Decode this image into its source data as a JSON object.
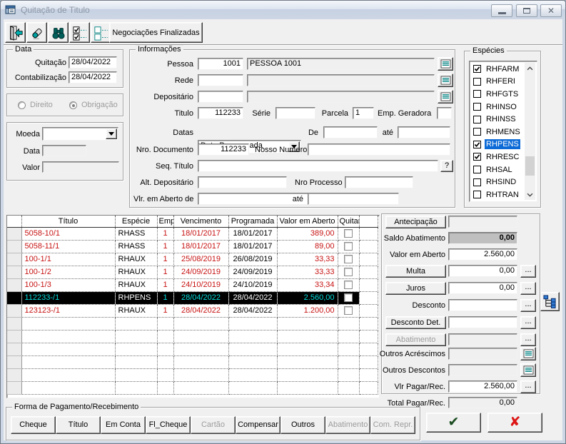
{
  "window": {
    "title": "Quitação de Titulo"
  },
  "toolbar": {
    "icons": [
      "exit-icon",
      "eraser-icon",
      "search-icon",
      "check-all-icon",
      "uncheck-all-icon"
    ],
    "finalizadas_label": "Negociações Finalizadas"
  },
  "data_group": {
    "title": "Data",
    "rows": [
      {
        "label": "Quitação",
        "value": "28/04/2022"
      },
      {
        "label": "Contabilização",
        "value": "28/04/2022"
      }
    ]
  },
  "tipo_group": {
    "options": [
      {
        "label": "Direito",
        "selected": false
      },
      {
        "label": "Obrigação",
        "selected": true
      }
    ]
  },
  "moeda_group": {
    "moeda_label": "Moeda",
    "moeda_value": "",
    "data_label": "Data",
    "data_value": "",
    "valor_label": "Valor",
    "valor_value": ""
  },
  "informacoes": {
    "title": "Informações",
    "pessoa_label": "Pessoa",
    "pessoa_code": "1001",
    "pessoa_name": "PESSOA 1001",
    "rede_label": "Rede",
    "rede_code": "",
    "rede_name": "",
    "depositario_label": "Depositário",
    "depositario_code": "",
    "depositario_name": "",
    "titulo_label": "Titulo",
    "titulo_value": "112233",
    "serie_label": "Série",
    "serie_value": "",
    "parcela_label": "Parcela",
    "parcela_value": "1",
    "emp_geradora_label": "Emp. Geradora",
    "emp_geradora_value": "",
    "datas_label": "Datas",
    "datas_value": "Data Programada",
    "de_label": "De",
    "de_value": "",
    "ate_label": "até",
    "ate_value": "",
    "nro_documento_label": "Nro. Documento",
    "nro_documento_value": "112233",
    "nosso_numero_label": "Nosso Numero",
    "nosso_numero_value": "",
    "seq_titulo_label": "Seq. Título",
    "seq_titulo_value": "",
    "help_label": "?",
    "alt_depositario_label": "Alt. Depositário",
    "alt_depositario_value": "",
    "nro_processo_label": "Nro Processo",
    "nro_processo_value": "",
    "vlr_aberto_label": "Vlr. em Aberto de",
    "vlr_aberto_de": "",
    "vlr_ate_label": "até",
    "vlr_aberto_ate": ""
  },
  "especies": {
    "title": "Espécies",
    "items": [
      {
        "label": "RHFARM",
        "checked": true,
        "selected": false
      },
      {
        "label": "RHFERI",
        "checked": false,
        "selected": false
      },
      {
        "label": "RHFGTS",
        "checked": false,
        "selected": false
      },
      {
        "label": "RHINSO",
        "checked": false,
        "selected": false
      },
      {
        "label": "RHINSS",
        "checked": false,
        "selected": false
      },
      {
        "label": "RHMENS",
        "checked": false,
        "selected": false
      },
      {
        "label": "RHPENS",
        "checked": true,
        "selected": true
      },
      {
        "label": "RHRESC",
        "checked": true,
        "selected": false
      },
      {
        "label": "RHSAL",
        "checked": false,
        "selected": false
      },
      {
        "label": "RHSIND",
        "checked": false,
        "selected": false
      },
      {
        "label": "RHTRAN",
        "checked": false,
        "selected": false
      }
    ]
  },
  "titles_table": {
    "headers": [
      "Título",
      "Espécie",
      "Emp",
      "Vencimento",
      "Programada",
      "Valor em Aberto",
      "Quitar"
    ],
    "rows": [
      {
        "titulo": "5058-10/1",
        "especie": "RHASS",
        "emp": "1",
        "vencimento": "18/01/2017",
        "programada": "18/01/2017",
        "valor": "389,00",
        "quitar": false,
        "selected": false
      },
      {
        "titulo": "5058-11/1",
        "especie": "RHASS",
        "emp": "1",
        "vencimento": "18/01/2017",
        "programada": "18/01/2017",
        "valor": "89,00",
        "quitar": false,
        "selected": false
      },
      {
        "titulo": "100-1/1",
        "especie": "RHAUX",
        "emp": "1",
        "vencimento": "25/08/2019",
        "programada": "26/08/2019",
        "valor": "33,33",
        "quitar": false,
        "selected": false
      },
      {
        "titulo": "100-1/2",
        "especie": "RHAUX",
        "emp": "1",
        "vencimento": "24/09/2019",
        "programada": "24/09/2019",
        "valor": "33,33",
        "quitar": false,
        "selected": false
      },
      {
        "titulo": "100-1/3",
        "especie": "RHAUX",
        "emp": "1",
        "vencimento": "24/10/2019",
        "programada": "24/10/2019",
        "valor": "33,34",
        "quitar": false,
        "selected": false
      },
      {
        "titulo": "112233-/1",
        "especie": "RHPENS",
        "emp": "1",
        "vencimento": "28/04/2022",
        "programada": "28/04/2022",
        "valor": "2.560,00",
        "quitar": false,
        "selected": true
      },
      {
        "titulo": "123123-/1",
        "especie": "RHAUX",
        "emp": "1",
        "vencimento": "28/04/2022",
        "programada": "28/04/2022",
        "valor": "1.200,00",
        "quitar": false,
        "selected": false
      }
    ],
    "empty_rows": 6
  },
  "right_panel": {
    "antecipacao_label": "Antecipação",
    "antecipacao_value": "",
    "saldo_abatimento_label": "Saldo Abatimento",
    "saldo_abatimento_value": "0,00",
    "valor_em_aberto_label": "Valor em Aberto",
    "valor_em_aberto_value": "2.560,00",
    "multa_label": "Multa",
    "multa_value": "0,00",
    "juros_label": "Juros",
    "juros_value": "0,00",
    "desconto_label": "Desconto",
    "desconto_value": "",
    "desconto_det_label": "Desconto Det.",
    "desconto_det_value": "",
    "abatimento_label": "Abatimento",
    "abatimento_value": "",
    "outros_acrescimos_label": "Outros Acréscimos",
    "outros_acrescimos_value": "",
    "outros_descontos_label": "Outros Descontos",
    "outros_descontos_value": "",
    "vlr_pagar_label": "Vlr Pagar/Rec.",
    "vlr_pagar_value": "2.560,00",
    "total_pagar_label": "Total Pagar/Rec.",
    "total_pagar_value": "0,00",
    "ellipsis_label": "..."
  },
  "payment": {
    "title": "Forma de Pagamento/Recebimento",
    "buttons": [
      {
        "label": "Cheque",
        "enabled": true
      },
      {
        "label": "Título",
        "enabled": true
      },
      {
        "label": "Em Conta",
        "enabled": true
      },
      {
        "label": "Fl_Cheque",
        "enabled": true
      },
      {
        "label": "Cartão",
        "enabled": false
      },
      {
        "label": "Compensar",
        "enabled": true
      },
      {
        "label": "Outros",
        "enabled": true
      },
      {
        "label": "Abatimento",
        "enabled": false
      },
      {
        "label": "Com. Repr.",
        "enabled": false
      }
    ]
  },
  "colors": {
    "negative_red": "#c81414",
    "selected_row_bg": "#000000",
    "selected_row_cyan": "#00dcdc",
    "selection_blue": "#0d6bd7",
    "teal_icon": "#008080",
    "check_green": "#1d4d21",
    "cross_red": "#dd1515"
  }
}
